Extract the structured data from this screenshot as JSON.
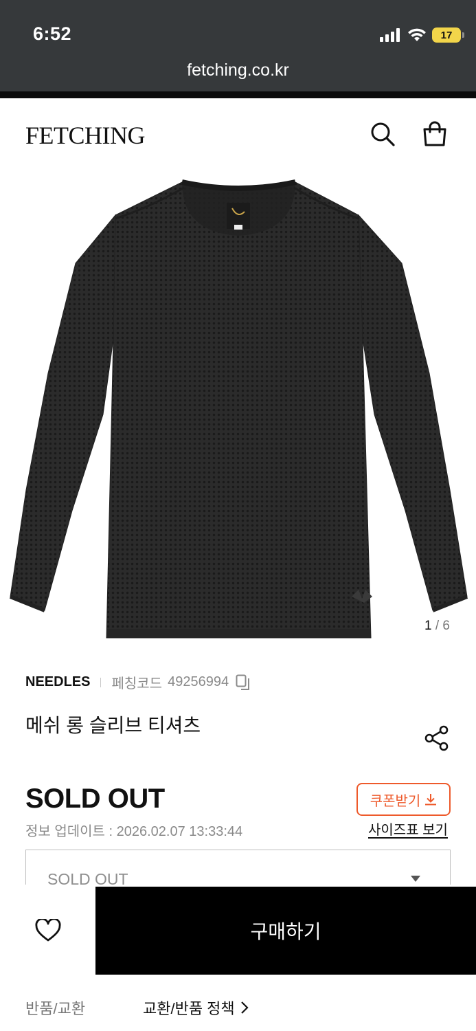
{
  "status_bar": {
    "time": "6:52",
    "battery": "17",
    "icons": [
      "signal-icon",
      "wifi-icon",
      "battery-icon"
    ]
  },
  "browser": {
    "url": "fetching.co.kr"
  },
  "header": {
    "logo": "FETCHING",
    "icons": [
      "search-icon",
      "shopping-bag-icon"
    ]
  },
  "gallery": {
    "current": "1",
    "separator": "/",
    "total": "6"
  },
  "product": {
    "brand": "NEEDLES",
    "code_label": "페칭코드",
    "code": "49256994",
    "name": "메쉬 롱 슬리브 티셔츠",
    "price": "SOLD OUT",
    "updated": "정보 업데이트 : 2026.02.07 13:33:44",
    "coupon_label": "쿠폰받기",
    "size_chart_label": "사이즈표 보기",
    "option_value": "SOLD OUT"
  },
  "purchase": {
    "buy_label": "구매하기"
  },
  "policy": {
    "label": "반품/교환",
    "link": "교환/반품 정책"
  },
  "colors": {
    "accent": "#ee5a2b",
    "chrome": "#36393b",
    "battery": "#f2d54a",
    "shirt": "#2b2b2b"
  }
}
